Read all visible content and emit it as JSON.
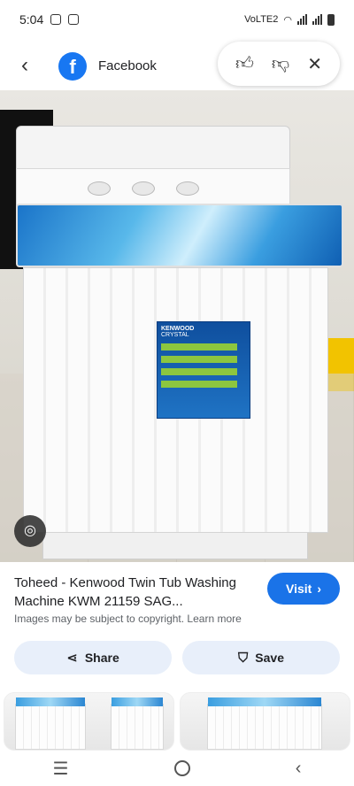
{
  "status_bar": {
    "time": "5:04",
    "network_label": "VoLTE2"
  },
  "header": {
    "source_name": "Facebook",
    "source_logo_letter": "f",
    "back_icon": "chevron-left-icon",
    "feedback": {
      "thumbs_up_icon": "thumbs-up-icon",
      "thumbs_down_icon": "thumbs-down-icon",
      "close_icon": "close-icon"
    }
  },
  "image": {
    "label_brand": "KENWOOD",
    "label_model": "CRYSTAL",
    "lens_icon": "google-lens-icon"
  },
  "result": {
    "title": "Toheed - Kenwood Twin Tub Washing Machine KWM 21159 SAG...",
    "copyright_note": "Images may be subject to copyright. Learn more",
    "visit_label": "Visit",
    "visit_icon": "chevron-right-icon"
  },
  "actions": {
    "share_label": "Share",
    "save_label": "Save"
  },
  "colors": {
    "accent": "#1a73e8",
    "pill_bg": "#e8effa",
    "facebook_blue": "#1877f2"
  }
}
